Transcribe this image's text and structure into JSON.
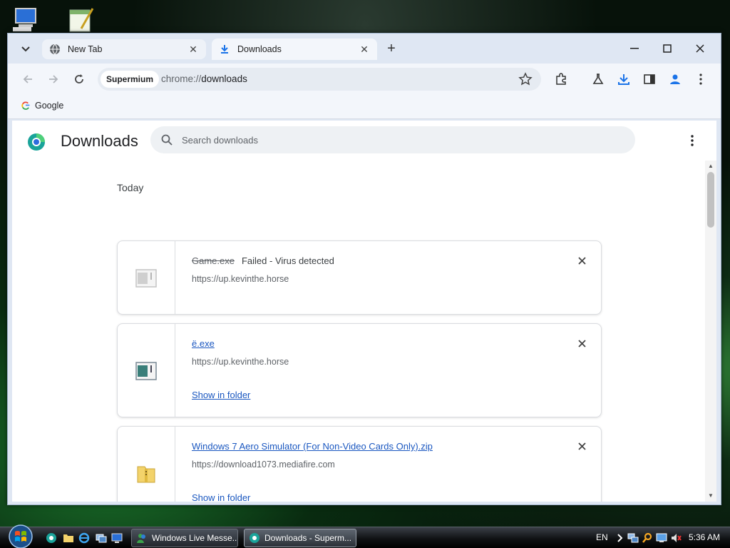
{
  "window": {
    "tabs": [
      {
        "label": "New Tab",
        "icon": "globe-icon"
      },
      {
        "label": "Downloads",
        "icon": "download-icon"
      }
    ]
  },
  "toolbar": {
    "chip_label": "Supermium",
    "url_scheme": "chrome://",
    "url_host": "downloads"
  },
  "bookmarks": [
    {
      "label": "Google",
      "icon": "google-icon"
    }
  ],
  "page": {
    "title": "Downloads",
    "search_placeholder": "Search downloads",
    "section_label": "Today"
  },
  "downloads": [
    {
      "name": "Game.exe",
      "status": "Failed - Virus detected",
      "url": "https://up.kevinthe.horse",
      "action": "",
      "failed": true
    },
    {
      "name": "ë.exe",
      "status": "",
      "url": "https://up.kevinthe.horse",
      "action": "Show in folder",
      "failed": false
    },
    {
      "name": "Windows 7 Aero Simulator (For Non-Video Cards Only).zip",
      "status": "",
      "url": "https://download1073.mediafire.com",
      "action": "Show in folder",
      "failed": false
    }
  ],
  "taskbar": {
    "buttons": [
      {
        "label": "Windows Live Messe..."
      },
      {
        "label": "Downloads - Superm..."
      }
    ],
    "language": "EN",
    "clock": "5:36 AM"
  },
  "colors": {
    "link": "#1a57c0",
    "accent": "#1a73e8",
    "frame": "#dfe7f3"
  }
}
